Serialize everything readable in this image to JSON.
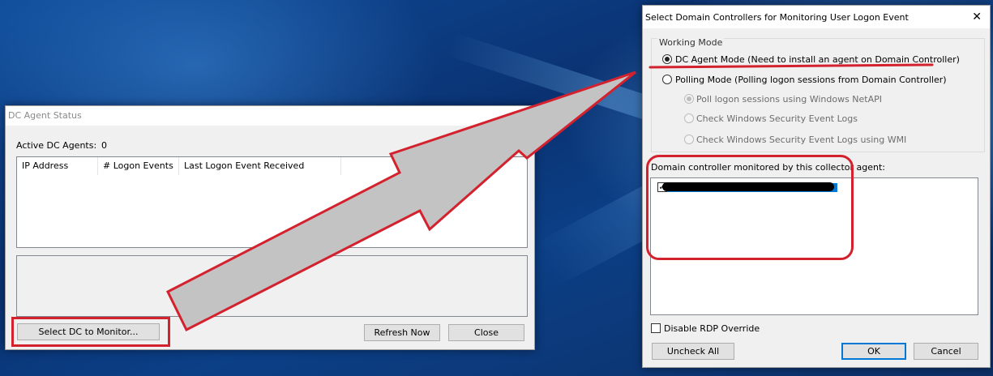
{
  "dc_agent_status": {
    "title": "DC Agent Status",
    "active_label": "Active DC Agents:",
    "active_count": "0",
    "columns": [
      "IP Address",
      "# Logon Events",
      "Last Logon Event Received"
    ],
    "select_button": "Select DC to Monitor...",
    "refresh_button": "Refresh Now",
    "close_button": "Close"
  },
  "select_dc_dialog": {
    "title": "Select Domain Controllers for Monitoring User Logon Event",
    "close_glyph": "✕",
    "working_mode_label": "Working Mode",
    "modes": [
      {
        "label": "DC Agent Mode (Need to install an agent on Domain Controller)",
        "selected": true
      },
      {
        "label": "Polling Mode (Polling logon sessions from Domain Controller)",
        "selected": false
      }
    ],
    "polling_options": [
      {
        "label": "Poll logon sessions using Windows NetAPI",
        "selected": true
      },
      {
        "label": "Check Windows Security Event Logs",
        "selected": false
      },
      {
        "label": "Check Windows Security Event Logs using WMI",
        "selected": false
      }
    ],
    "dc_list_label": "Domain controller monitored by this collector agent:",
    "dc_item_check": "✓",
    "disable_rdp_label": "Disable RDP Override",
    "uncheck_all_button": "Uncheck All",
    "ok_button": "OK",
    "cancel_button": "Cancel"
  },
  "colors": {
    "annotation_red": "#d4212e",
    "arrow_fill": "#c3c3c3",
    "selection_blue": "#0078d7"
  }
}
